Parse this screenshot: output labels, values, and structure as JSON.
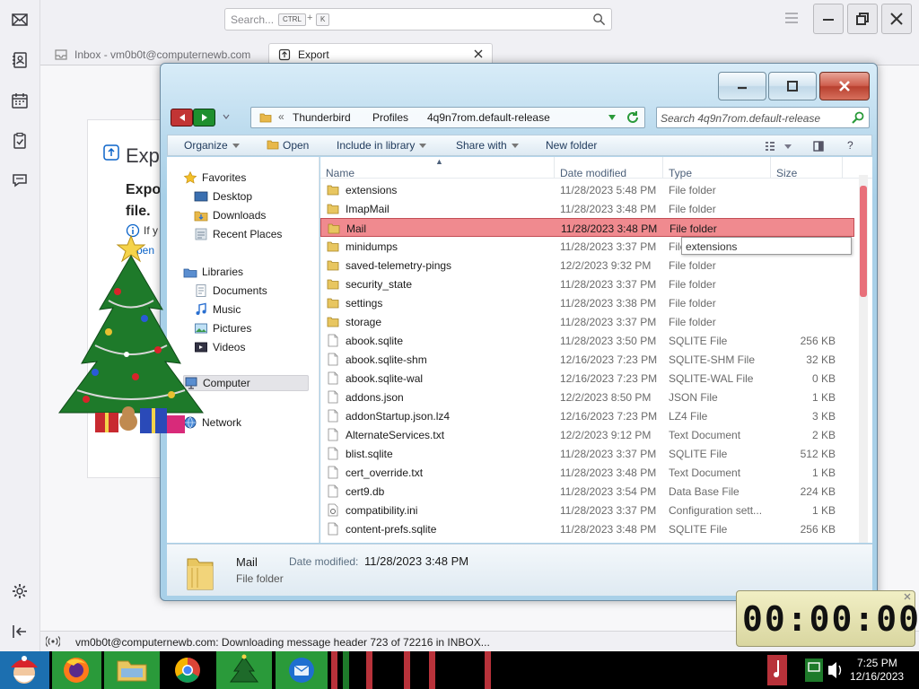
{
  "thunderbird": {
    "search_placeholder": "Search...",
    "search_key1": "CTRL",
    "search_plus": "+",
    "search_key2": "K",
    "tabs": [
      {
        "label": "Inbox - vm0b0t@computernewb.com"
      },
      {
        "label": "Export"
      }
    ],
    "export_page": {
      "title": "Expo",
      "heading": "Expo\nfile.",
      "info_text": "If y",
      "link_text": "pen"
    },
    "status_text": "vm0b0t@computernewb.com: Downloading message header 723 of 72216 in INBOX..."
  },
  "explorer": {
    "breadcrumbs": [
      "Thunderbird",
      "Profiles",
      "4q9n7rom.default-release"
    ],
    "search_placeholder": "Search 4q9n7rom.default-release",
    "commands": {
      "organize": "Organize",
      "open": "Open",
      "include": "Include in library",
      "share": "Share with",
      "new_folder": "New folder"
    },
    "nav": {
      "favorites": "Favorites",
      "desktop": "Desktop",
      "downloads": "Downloads",
      "recent": "Recent Places",
      "libraries": "Libraries",
      "documents": "Documents",
      "music": "Music",
      "pictures": "Pictures",
      "videos": "Videos",
      "computer": "Computer",
      "network": "Network"
    },
    "columns": {
      "name": "Name",
      "date": "Date modified",
      "type": "Type",
      "size": "Size"
    },
    "files": [
      {
        "name": "extensions",
        "date": "11/28/2023 5:48 PM",
        "type": "File folder",
        "size": "",
        "kind": "folder"
      },
      {
        "name": "ImapMail",
        "date": "11/28/2023 3:48 PM",
        "type": "File folder",
        "size": "",
        "kind": "folder"
      },
      {
        "name": "Mail",
        "date": "11/28/2023 3:48 PM",
        "type": "File folder",
        "size": "",
        "kind": "folder"
      },
      {
        "name": "minidumps",
        "date": "11/28/2023 3:37 PM",
        "type": "File folder",
        "size": "",
        "kind": "folder"
      },
      {
        "name": "saved-telemetry-pings",
        "date": "12/2/2023 9:32 PM",
        "type": "File folder",
        "size": "",
        "kind": "folder"
      },
      {
        "name": "security_state",
        "date": "11/28/2023 3:37 PM",
        "type": "File folder",
        "size": "",
        "kind": "folder"
      },
      {
        "name": "settings",
        "date": "11/28/2023 3:38 PM",
        "type": "File folder",
        "size": "",
        "kind": "folder"
      },
      {
        "name": "storage",
        "date": "11/28/2023 3:37 PM",
        "type": "File folder",
        "size": "",
        "kind": "folder"
      },
      {
        "name": "abook.sqlite",
        "date": "11/28/2023 3:50 PM",
        "type": "SQLITE File",
        "size": "256 KB",
        "kind": "file"
      },
      {
        "name": "abook.sqlite-shm",
        "date": "12/16/2023 7:23 PM",
        "type": "SQLITE-SHM File",
        "size": "32 KB",
        "kind": "file"
      },
      {
        "name": "abook.sqlite-wal",
        "date": "12/16/2023 7:23 PM",
        "type": "SQLITE-WAL File",
        "size": "0 KB",
        "kind": "file"
      },
      {
        "name": "addons.json",
        "date": "12/2/2023 8:50 PM",
        "type": "JSON File",
        "size": "1 KB",
        "kind": "file"
      },
      {
        "name": "addonStartup.json.lz4",
        "date": "12/16/2023 7:23 PM",
        "type": "LZ4 File",
        "size": "3 KB",
        "kind": "file"
      },
      {
        "name": "AlternateServices.txt",
        "date": "12/2/2023 9:12 PM",
        "type": "Text Document",
        "size": "2 KB",
        "kind": "file"
      },
      {
        "name": "blist.sqlite",
        "date": "11/28/2023 3:37 PM",
        "type": "SQLITE File",
        "size": "512 KB",
        "kind": "file"
      },
      {
        "name": "cert_override.txt",
        "date": "11/28/2023 3:48 PM",
        "type": "Text Document",
        "size": "1 KB",
        "kind": "file"
      },
      {
        "name": "cert9.db",
        "date": "11/28/2023 3:54 PM",
        "type": "Data Base File",
        "size": "224 KB",
        "kind": "file"
      },
      {
        "name": "compatibility.ini",
        "date": "11/28/2023 3:37 PM",
        "type": "Configuration sett...",
        "size": "1 KB",
        "kind": "ini"
      },
      {
        "name": "content-prefs.sqlite",
        "date": "11/28/2023 3:48 PM",
        "type": "SQLITE File",
        "size": "256 KB",
        "kind": "file"
      }
    ],
    "selected_index": 2,
    "tooltip": "extensions",
    "details": {
      "name": "Mail",
      "type": "File folder",
      "date_label": "Date modified:",
      "date_value": "11/28/2023 3:48 PM"
    }
  },
  "timer": "00:00:00",
  "clock": {
    "time": "7:25 PM",
    "date": "12/16/2023"
  },
  "colors": {
    "selection": "#f08a8f",
    "scroll_thumb": "#e8707a",
    "nav_back": "#c23434",
    "nav_forward": "#1e8f2e"
  }
}
